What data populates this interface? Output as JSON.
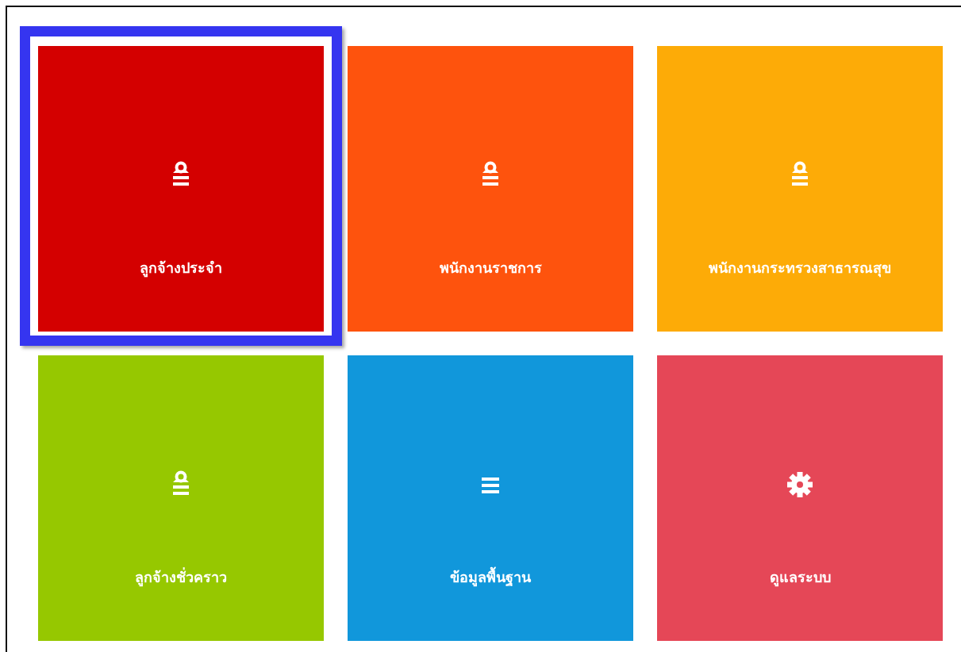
{
  "tiles": [
    {
      "label": "ลูกจ้างประจำ",
      "kind": "person",
      "color": "#d40000",
      "selected": true
    },
    {
      "label": "พนักงานราชการ",
      "kind": "person",
      "color": "#fe530d",
      "selected": false
    },
    {
      "label": "พนักงานกระทรวงสาธารณสุข",
      "kind": "person",
      "color": "#fdab07",
      "selected": false
    },
    {
      "label": "ลูกจ้างชั่วคราว",
      "kind": "person",
      "color": "#96c800",
      "selected": false
    },
    {
      "label": "ข้อมูลพื้นฐาน",
      "kind": "list",
      "color": "#1197db",
      "selected": false
    },
    {
      "label": "ดูแลระบบ",
      "kind": "gear",
      "color": "#e54757",
      "selected": false
    }
  ]
}
